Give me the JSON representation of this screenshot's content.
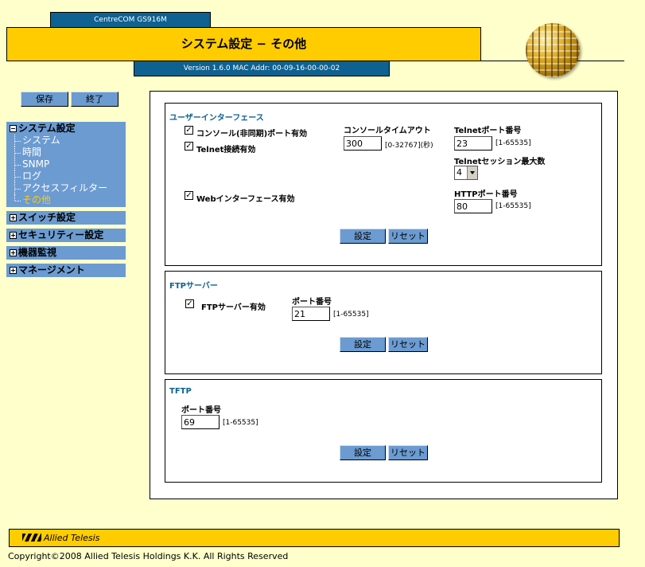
{
  "header": {
    "model": "CentreCOM GS916M",
    "title": "システム設定 − その他",
    "version": "Version 1.6.0 MAC Addr: 00-09-16-00-00-02"
  },
  "toolbar": {
    "save_label": "保存",
    "exit_label": "終了"
  },
  "sidebar": {
    "system_settings": {
      "label": "システム設定",
      "items": [
        {
          "label": "システム"
        },
        {
          "label": "時間"
        },
        {
          "label": "SNMP"
        },
        {
          "label": "ログ"
        },
        {
          "label": "アクセスフィルター"
        },
        {
          "label": "その他"
        }
      ]
    },
    "switch_settings": {
      "label": "スイッチ設定"
    },
    "security_settings": {
      "label": "セキュリティー設定"
    },
    "device_monitoring": {
      "label": "機器監視"
    },
    "management": {
      "label": "マネージメント"
    }
  },
  "ui_section": {
    "title": "ユーザーインターフェース",
    "console_enabled": {
      "label": "コンソール(非同期)ポート有効",
      "checked": true
    },
    "telnet_enabled": {
      "label": "Telnet接続有効",
      "checked": true
    },
    "web_enabled": {
      "label": "Webインターフェース有効",
      "checked": true
    },
    "console_timeout": {
      "label": "コンソールタイムアウト",
      "value": "300",
      "range": "[0-32767](秒)"
    },
    "telnet_port": {
      "label": "Telnetポート番号",
      "value": "23",
      "range": "[1-65535]"
    },
    "telnet_sessions": {
      "label": "Telnetセッション最大数",
      "value": "4"
    },
    "http_port": {
      "label": "HTTPポート番号",
      "value": "80",
      "range": "[1-65535]"
    },
    "set_label": "設定",
    "reset_label": "リセット"
  },
  "ftp_section": {
    "title": "FTPサーバー",
    "ftp_enabled": {
      "label": "FTPサーバー有効",
      "checked": true
    },
    "port": {
      "label": "ポート番号",
      "value": "21",
      "range": "[1-65535]"
    },
    "set_label": "設定",
    "reset_label": "リセット"
  },
  "tftp_section": {
    "title": "TFTP",
    "port": {
      "label": "ポート番号",
      "value": "69",
      "range": "[1-65535]"
    },
    "set_label": "設定",
    "reset_label": "リセット"
  },
  "footer": {
    "logo": "Allied Telesis",
    "copyright": "Copyright©2008 Allied Telesis Holdings K.K. All Rights Reserved"
  }
}
